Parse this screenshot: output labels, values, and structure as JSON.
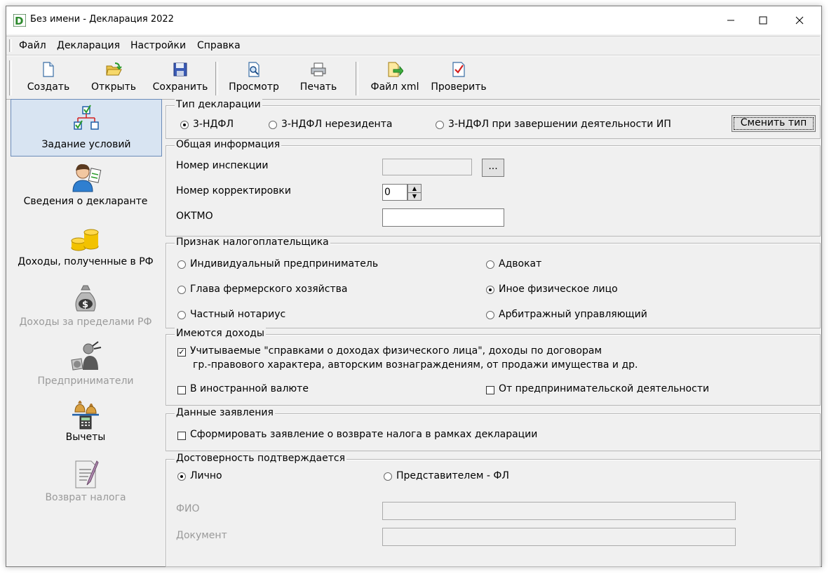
{
  "window": {
    "title": "Без имени - Декларация 2022",
    "controls": {
      "minimize": "—",
      "maximize": "☐",
      "close": "✕"
    }
  },
  "menu": [
    "Файл",
    "Декларация",
    "Настройки",
    "Справка"
  ],
  "toolbar": {
    "create": "Создать",
    "open": "Открыть",
    "save": "Сохранить",
    "preview": "Просмотр",
    "print": "Печать",
    "xml": "Файл xml",
    "check": "Проверить"
  },
  "sidebar": [
    {
      "label": "Задание условий",
      "icon": "tree-icon",
      "active": true,
      "enabled": true
    },
    {
      "label": "Сведения о декларанте",
      "icon": "person-icon",
      "active": false,
      "enabled": true
    },
    {
      "label": "Доходы, полученные в РФ",
      "icon": "coins-icon",
      "active": false,
      "enabled": true
    },
    {
      "label": "Доходы за пределами РФ",
      "icon": "money-bag-icon",
      "active": false,
      "enabled": false
    },
    {
      "label": "Предприниматели",
      "icon": "entrepreneur-icon",
      "active": false,
      "enabled": false
    },
    {
      "label": "Вычеты",
      "icon": "deductions-icon",
      "active": false,
      "enabled": true
    },
    {
      "label": "Возврат налога",
      "icon": "document-icon",
      "active": false,
      "enabled": false
    }
  ],
  "declaration_type": {
    "legend": "Тип декларации",
    "options": [
      "3-НДФЛ",
      "3-НДФЛ нерезидента",
      "3-НДФЛ при завершении деятельности ИП"
    ],
    "selected": "3-НДФЛ",
    "change_button": "Сменить тип"
  },
  "general_info": {
    "legend": "Общая информация",
    "inspection_label": "Номер инспекции",
    "inspection_value": "",
    "browse_button": "...",
    "correction_label": "Номер корректировки",
    "correction_value": "0",
    "oktmo_label": "ОКТМО",
    "oktmo_value": ""
  },
  "taxpayer": {
    "legend": "Признак налогоплательщика",
    "options": [
      "Индивидуальный предприниматель",
      "Адвокат",
      "Глава фермерского хозяйства",
      "Иное физическое лицо",
      "Частный нотариус",
      "Арбитражный управляющий"
    ],
    "selected": "Иное физическое лицо"
  },
  "income": {
    "legend": "Имеются доходы",
    "certified_line1": "Учитываемые \"справками о доходах физического лица\", доходы по договорам",
    "certified_line2": "гр.-правового характера, авторским вознаграждениям, от продажи имущества и др.",
    "certified_checked": true,
    "foreign_currency": "В иностранной валюте",
    "foreign_currency_checked": false,
    "business": "От предпринимательской деятельности",
    "business_checked": false
  },
  "application": {
    "legend": "Данные заявления",
    "refund_label": "Сформировать заявление о возврате налога в рамках декларации",
    "refund_checked": false
  },
  "reliability": {
    "legend": "Достоверность подтверждается",
    "personally": "Лично",
    "representative": "Представителем - ФЛ",
    "selected": "Лично",
    "fio_label": "ФИО",
    "fio_value": "",
    "document_label": "Документ",
    "document_value": ""
  }
}
